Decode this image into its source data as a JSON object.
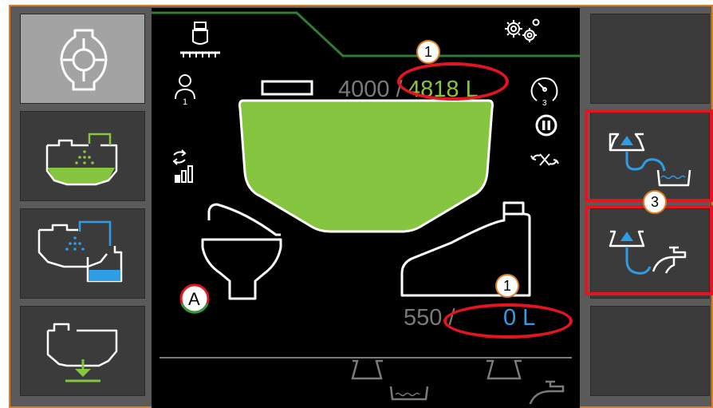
{
  "colors": {
    "panel_bg": "#5a5a5a",
    "button_bg": "#3b3b3b",
    "button_active_bg": "#a3a3a3",
    "screen_bg": "#000000",
    "tank_fill": "#86c540",
    "accent_green": "#86c540",
    "accent_blue": "#2e9de6",
    "highlight_red": "#e6141e",
    "frame_orange": "#e07b1e"
  },
  "left_menu": [
    {
      "icon": "pump-valve-icon",
      "active": true
    },
    {
      "icon": "main-tank-fill-icon",
      "active": false
    },
    {
      "icon": "rinse-tank-transfer-icon",
      "active": false
    },
    {
      "icon": "tank-drain-icon",
      "active": false
    }
  ],
  "right_menu": [
    {
      "icon": "blank",
      "active": false
    },
    {
      "icon": "fill-from-basin-icon",
      "active": false
    },
    {
      "icon": "fill-from-tap-icon",
      "active": false
    },
    {
      "icon": "blank",
      "active": false
    }
  ],
  "main_tank": {
    "capacity": "4000 /",
    "current": "4818 L",
    "fill_level": 1.0
  },
  "rinse_tank": {
    "capacity": "550 /",
    "current": "0 L",
    "fill_level": 0.0
  },
  "status_icons": {
    "sprayer": "sprayer-boom-icon",
    "settings": "gears-icon",
    "operator": "operator-icon",
    "operator_number": "1",
    "signal": "signal-level-icon",
    "gauge": "pressure-gauge-icon",
    "gauge_number": "3",
    "pause": "pause-icon",
    "no_agitation": "agitation-off-icon",
    "auto_mode": "A"
  },
  "callouts": {
    "main_value": "1",
    "rinse_value": "1",
    "fill_buttons": "3"
  }
}
